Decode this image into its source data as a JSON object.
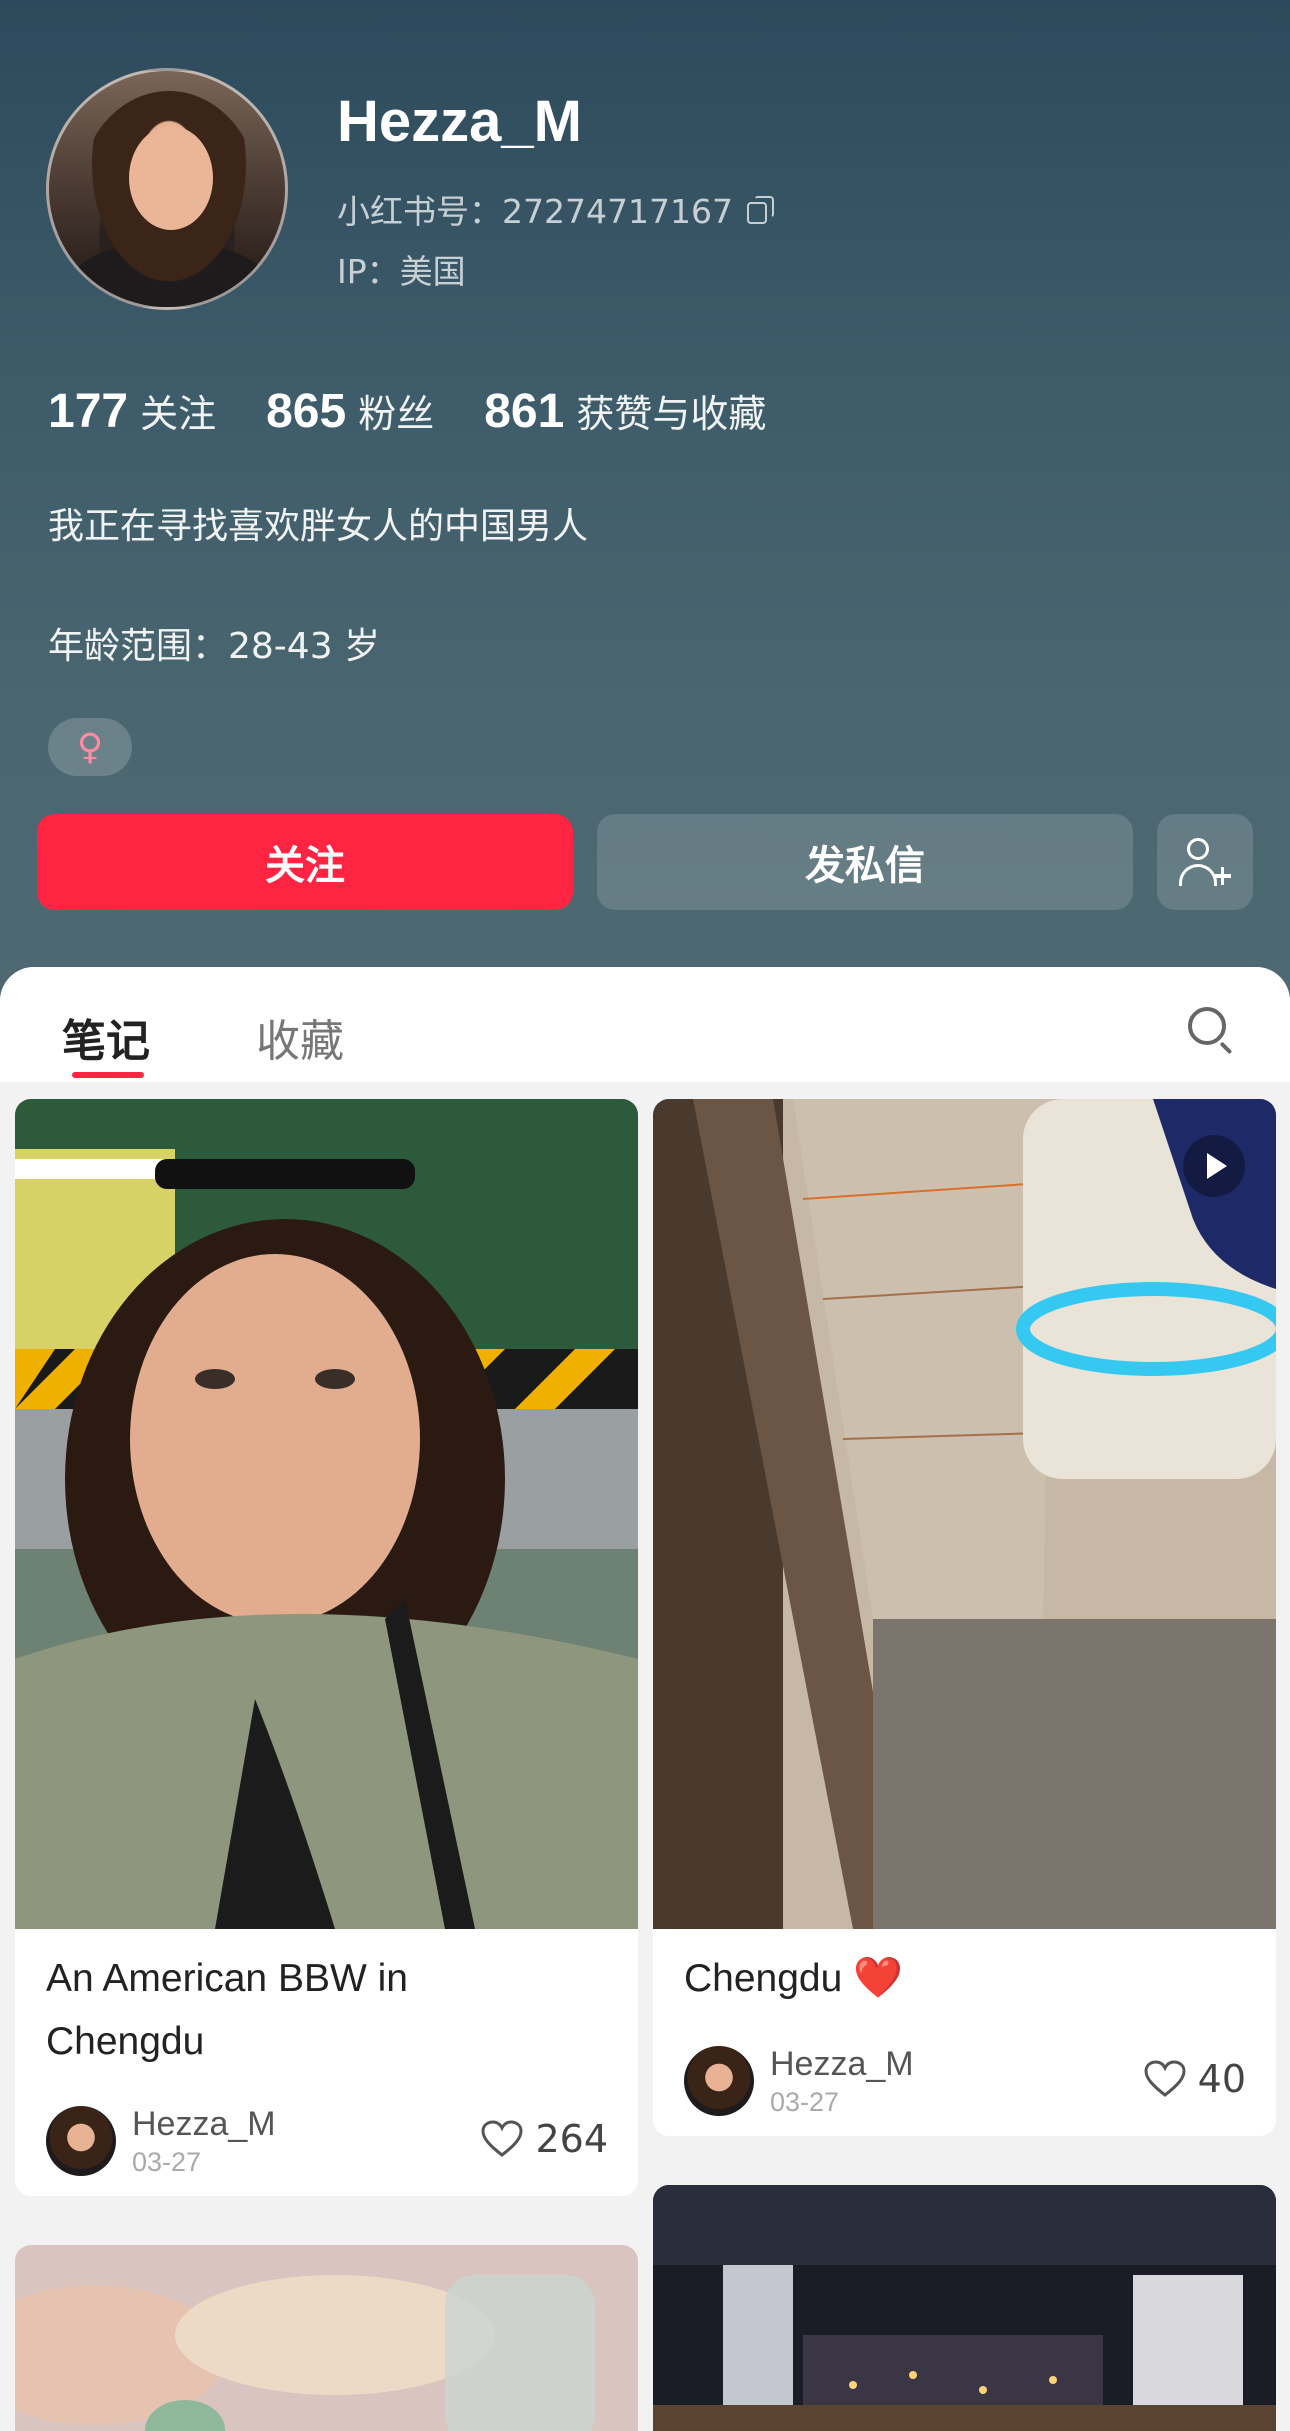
{
  "profile": {
    "name": "Hezza_M",
    "id_text": "小红书号：27274717167",
    "ip_text": "IP：美国",
    "following_count": "177",
    "following_label": "关注",
    "fans_count": "865",
    "fans_label": "粉丝",
    "likes_count": "861",
    "likes_label": "获赞与收藏",
    "bio_line1": "我正在寻找喜欢胖女人的中国男人",
    "bio_line2": "年龄范围：28-43 岁",
    "gender_symbol": "♀"
  },
  "actions": {
    "follow_label": "关注",
    "message_label": "发私信"
  },
  "tabs": {
    "notes": "笔记",
    "collections": "收藏"
  },
  "notes": [
    {
      "title": "An American BBW in Chengdu",
      "author": "Hezza_M",
      "date": "03-27",
      "likes": "264"
    },
    {
      "title": "Chengdu",
      "title_emoji": "❤️",
      "author": "Hezza_M",
      "date": "03-27",
      "likes": "40",
      "is_video": true
    }
  ],
  "colors": {
    "accent": "#ff2442",
    "header_top": "#2d4a5c",
    "header_bottom": "#4e6972"
  },
  "icons": [
    "copy-icon",
    "add-user-icon",
    "search-icon",
    "heart-icon",
    "play-icon"
  ]
}
